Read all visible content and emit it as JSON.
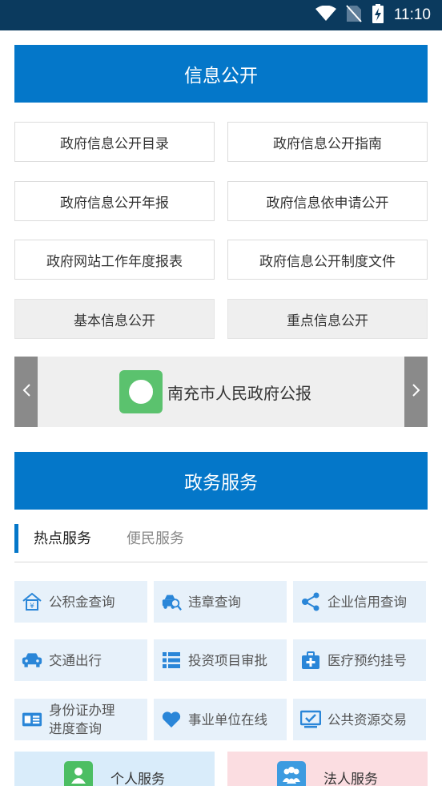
{
  "status_bar": {
    "time": "11:10"
  },
  "info_section": {
    "title": "信息公开",
    "buttons": [
      "政府信息公开目录",
      "政府信息公开指南",
      "政府信息公开年报",
      "政府信息依申请公开",
      "政府网站工作年度报表",
      "政府信息公开制度文件",
      "基本信息公开",
      "重点信息公开"
    ]
  },
  "carousel": {
    "label": "南充市人民政府公报"
  },
  "gov_section": {
    "title": "政务服务",
    "tabs": {
      "active": "热点服务",
      "inactive": "便民服务"
    },
    "services": [
      {
        "label": "公积金查询",
        "icon": "house-yuan-icon"
      },
      {
        "label": "违章查询",
        "icon": "car-search-icon"
      },
      {
        "label": "企业信用查询",
        "icon": "share-icon"
      },
      {
        "label": "交通出行",
        "icon": "car-icon"
      },
      {
        "label": "投资项目审批",
        "icon": "list-icon"
      },
      {
        "label": "医疗预约挂号",
        "icon": "medical-kit-icon"
      },
      {
        "label_line1": "身份证办理",
        "label_line2": "进度查询",
        "icon": "id-card-icon"
      },
      {
        "label": "事业单位在线",
        "icon": "heart-icon"
      },
      {
        "label": "公共资源交易",
        "icon": "monitor-check-icon"
      }
    ],
    "bottom": [
      {
        "label": "个人服务",
        "icon": "person-icon"
      },
      {
        "label": "法人服务",
        "icon": "group-icon"
      }
    ]
  },
  "colors": {
    "primary": "#0477c9",
    "service_bg": "#e7f1fa",
    "icon_blue": "#2a86d8"
  }
}
